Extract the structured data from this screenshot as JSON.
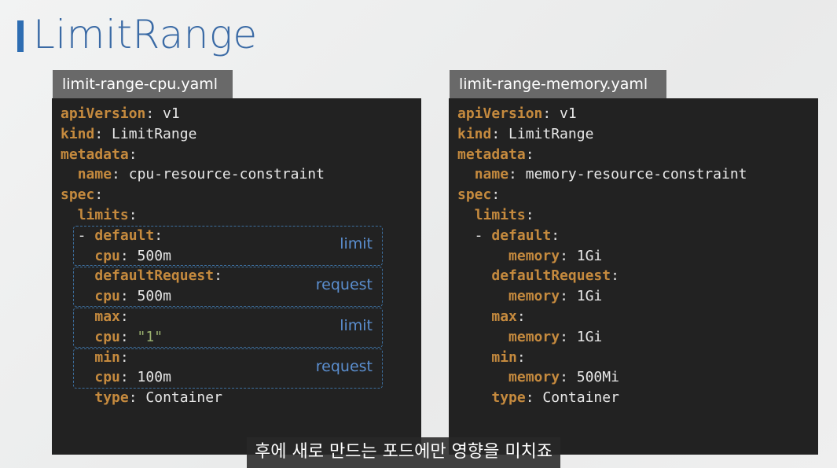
{
  "slide": {
    "title": "LimitRange"
  },
  "cpu_file": {
    "tab": "limit-range-cpu.yaml",
    "lines": [
      {
        "indent": "",
        "key": "apiVersion",
        "val": "v1"
      },
      {
        "indent": "",
        "key": "kind",
        "val": "LimitRange"
      },
      {
        "indent": "",
        "key": "metadata",
        "val": ""
      },
      {
        "indent": "  ",
        "key": "name",
        "val": "cpu-resource-constraint"
      },
      {
        "indent": "",
        "key": "spec",
        "val": ""
      },
      {
        "indent": "  ",
        "key": "limits",
        "val": ""
      },
      {
        "indent": "  - ",
        "key": "default",
        "val": ""
      },
      {
        "indent": "    ",
        "key": "cpu",
        "val": "500m"
      },
      {
        "indent": "    ",
        "key": "defaultRequest",
        "val": ""
      },
      {
        "indent": "    ",
        "key": "cpu",
        "val": "500m"
      },
      {
        "indent": "    ",
        "key": "max",
        "val": ""
      },
      {
        "indent": "    ",
        "key": "cpu",
        "val": "\"1\"",
        "string": true
      },
      {
        "indent": "    ",
        "key": "min",
        "val": ""
      },
      {
        "indent": "    ",
        "key": "cpu",
        "val": "100m"
      },
      {
        "indent": "    ",
        "key": "type",
        "val": "Container"
      }
    ],
    "annotations": [
      "limit",
      "request",
      "limit",
      "request"
    ]
  },
  "memory_file": {
    "tab": "limit-range-memory.yaml",
    "lines": [
      {
        "indent": "",
        "key": "apiVersion",
        "val": "v1"
      },
      {
        "indent": "",
        "key": "kind",
        "val": "LimitRange"
      },
      {
        "indent": "",
        "key": "metadata",
        "val": ""
      },
      {
        "indent": "  ",
        "key": "name",
        "val": "memory-resource-constraint"
      },
      {
        "indent": "",
        "key": "spec",
        "val": ""
      },
      {
        "indent": "  ",
        "key": "limits",
        "val": ""
      },
      {
        "indent": "  - ",
        "key": "default",
        "val": ""
      },
      {
        "indent": "      ",
        "key": "memory",
        "val": "1Gi"
      },
      {
        "indent": "    ",
        "key": "defaultRequest",
        "val": ""
      },
      {
        "indent": "      ",
        "key": "memory",
        "val": "1Gi"
      },
      {
        "indent": "    ",
        "key": "max",
        "val": ""
      },
      {
        "indent": "      ",
        "key": "memory",
        "val": "1Gi"
      },
      {
        "indent": "    ",
        "key": "min",
        "val": ""
      },
      {
        "indent": "      ",
        "key": "memory",
        "val": "500Mi"
      },
      {
        "indent": "    ",
        "key": "type",
        "val": "Container"
      }
    ]
  },
  "caption": "후에 새로 만드는 포드에만 영향을 미치죠",
  "colors": {
    "title": "#3a6aa5",
    "accent_bar": "#2e6db2",
    "yaml_key": "#c58a3e",
    "yaml_string": "#9ab06f",
    "annotation": "#5b8fd0"
  }
}
